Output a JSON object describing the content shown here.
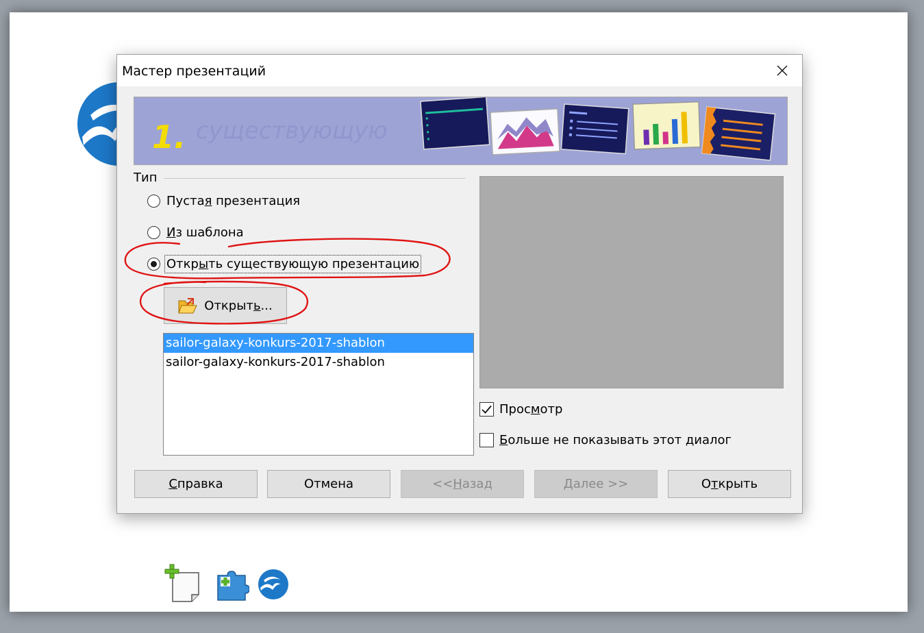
{
  "dialog": {
    "title": "Мастер презентаций",
    "banner_step": "1."
  },
  "type_group": {
    "label": "Тип",
    "options": [
      {
        "label_pre": "Пуста",
        "label_key": "я",
        "label_post": " презентация",
        "checked": false
      },
      {
        "label_pre": "",
        "label_key": "И",
        "label_post": "з шаблона",
        "checked": false
      },
      {
        "label_pre": "Откр",
        "label_key": "ы",
        "label_post": "ть существующую презентацию",
        "checked": true
      }
    ]
  },
  "open_button": {
    "label_pre": "Открыт",
    "label_key": "ь",
    "label_post": "..."
  },
  "file_list": {
    "items": [
      {
        "label": "sailor-galaxy-konkurs-2017-shablon",
        "selected": true
      },
      {
        "label": "sailor-galaxy-konkurs-2017-shablon",
        "selected": false
      }
    ]
  },
  "preview_checkbox": {
    "label_pre": "Прос",
    "label_key": "м",
    "label_post": "отр",
    "checked": true
  },
  "dont_show_checkbox": {
    "label_pre": "",
    "label_key": "Б",
    "label_post": "ольше не показывать этот диалог",
    "checked": false
  },
  "buttons": {
    "help": {
      "label_pre": "",
      "label_key": "С",
      "label_post": "правка",
      "enabled": true
    },
    "cancel": {
      "label": "Отмена",
      "enabled": true
    },
    "back": {
      "label_pre": "<< ",
      "label_key": "Н",
      "label_post": "азад",
      "enabled": false
    },
    "next": {
      "label_pre": "",
      "label_key": "Д",
      "label_post": "алее >>",
      "enabled": false
    },
    "open": {
      "label_pre": "О",
      "label_key": "т",
      "label_post": "крыть",
      "enabled": true
    }
  },
  "colors": {
    "selection": "#3399ff",
    "annotation": "#e01414",
    "logo_blue": "#1d78c8",
    "banner_bg": "#9ea3d6"
  },
  "icons": {
    "close": "close-icon",
    "open_folder": "open-folder-icon",
    "logo": "openoffice-logo-icon",
    "new_document": "new-document-icon",
    "extensions": "extension-icon"
  }
}
